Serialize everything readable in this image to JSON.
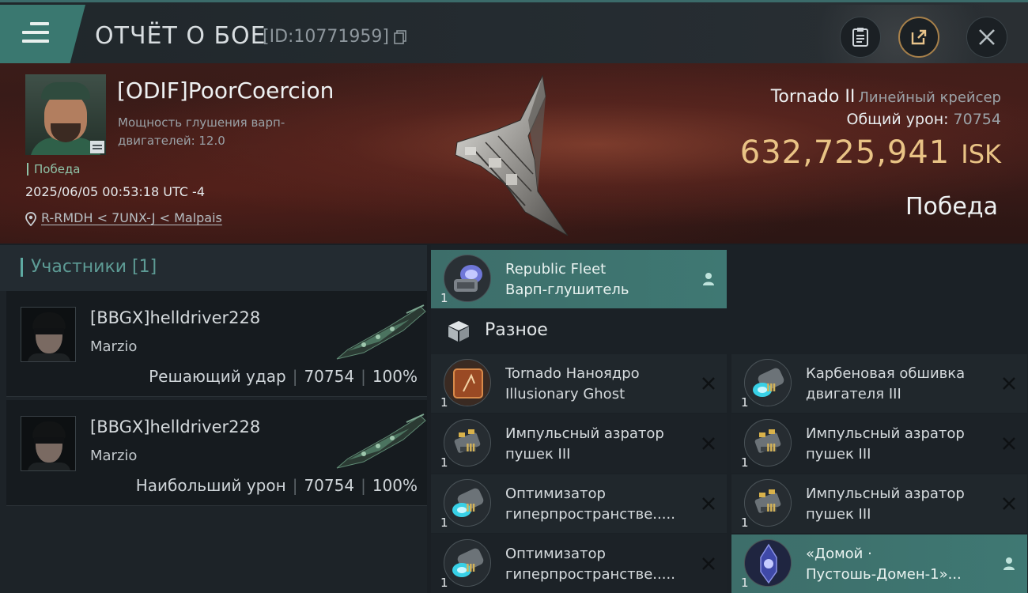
{
  "header": {
    "title": "ОТЧЁТ О БОЕ",
    "report_id": "[ID:10771959]",
    "icons": [
      "menu-icon",
      "copy-icon",
      "clipboard-icon",
      "share-icon",
      "close-icon"
    ]
  },
  "victim": {
    "name": "[ODIF]PoorCoercion",
    "warp_strength_label": "Мощность глушения варп-двигателей: 12.0",
    "status": "Победа",
    "datetime": "2025/06/05 00:53:18 UTC -4",
    "location": "R-RMDH < 7UNX-J < Malpais",
    "ship_name": "Tornado II",
    "ship_class": "Линейный крейсер",
    "total_damage_label": "Общий урон:",
    "total_damage": "70754",
    "isk_value": "632,725,941",
    "currency": "ISK",
    "result": "Победа"
  },
  "participants": {
    "title": "Участники [1]",
    "list": [
      {
        "name": "[BBGX]helldriver228",
        "corp": "Marzio",
        "role": "Решающий удар",
        "damage": "70754",
        "percent": "100%"
      },
      {
        "name": "[BBGX]helldriver228",
        "corp": "Marzio",
        "role": "Наибольший урон",
        "damage": "70754",
        "percent": "100%"
      }
    ]
  },
  "items": {
    "top": {
      "qty": "1",
      "line1": "Republic Fleet",
      "line2": "Варп-глушитель",
      "status": "dropped"
    },
    "section_label": "Разное",
    "grid": [
      {
        "qty": "1",
        "line1": "Tornado Наноядро",
        "line2": "Illusionary Ghost",
        "status": "destroyed"
      },
      {
        "qty": "1",
        "line1": "Карбеновая обшивка",
        "line2": "двигателя III",
        "status": "destroyed"
      },
      {
        "qty": "1",
        "line1": "Импульсный азратор",
        "line2": "пушек III",
        "status": "destroyed"
      },
      {
        "qty": "1",
        "line1": "Импульсный азратор",
        "line2": "пушек III",
        "status": "destroyed"
      },
      {
        "qty": "1",
        "line1": "Оптимизатор",
        "line2": "гиперпространстве.....",
        "status": "destroyed"
      },
      {
        "qty": "1",
        "line1": "Импульсный азратор",
        "line2": "пушек III",
        "status": "destroyed"
      },
      {
        "qty": "1",
        "line1": "Оптимизатор",
        "line2": "гиперпространстве.....",
        "status": "destroyed"
      },
      {
        "qty": "1",
        "line1": "«Домой ·",
        "line2": "Пустошь-Домен-1»...",
        "status": "dropped"
      }
    ]
  },
  "colors": {
    "accent_teal": "#3f7873",
    "isk_gold": "#e9c385",
    "victory_green": "#8fc3a8"
  }
}
